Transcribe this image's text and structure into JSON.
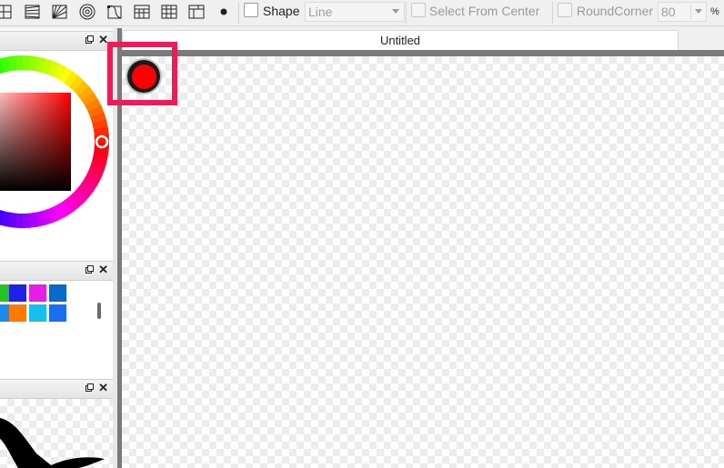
{
  "toolbar": {
    "shape_label": "Shape",
    "shape_value": "Line",
    "select_from_center_label": "Select From Center",
    "round_corner_label": "RoundCorner",
    "round_corner_value": "80",
    "percent_label": "%",
    "icons": [
      "grid-split-icon",
      "perspective-lines-icon",
      "radial-lines-icon",
      "concentric-circles-icon",
      "curve-rect-icon",
      "grid-3-icon",
      "grid-4-icon",
      "panel-grid-icon",
      "dot-icon"
    ]
  },
  "document": {
    "tab_title": "Untitled"
  },
  "colors": {
    "current_color": "#ff0000",
    "highlight": "#f0195a"
  },
  "swatches": [
    "#22c322",
    "#2020e8",
    "#e81ee8",
    "#0a6acb",
    "#1a8aee",
    "#ff7a00",
    "#16c0ee",
    "#1a6ef0"
  ]
}
